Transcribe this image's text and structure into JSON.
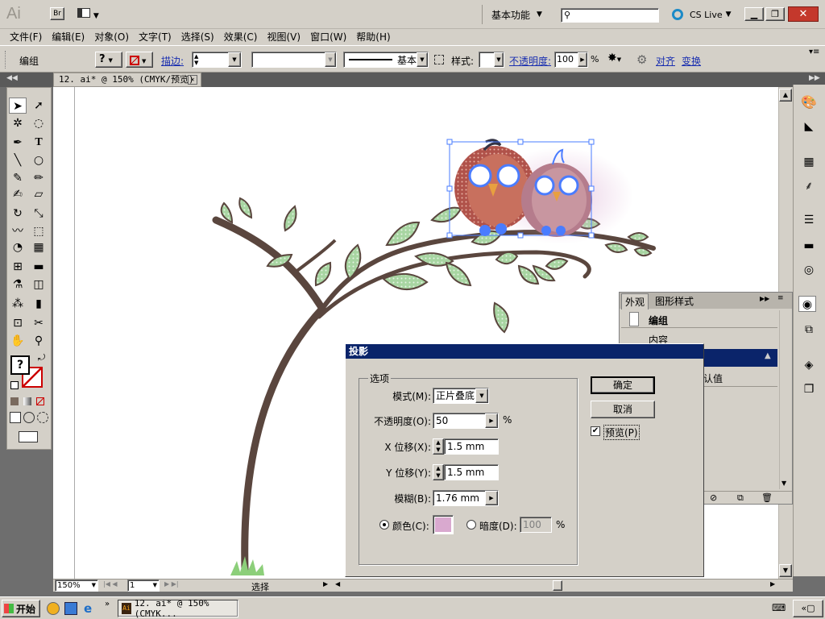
{
  "app": {
    "logo": "Ai",
    "br_badge": "Br",
    "workspace": "基本功能",
    "search_placeholder": "",
    "cs_live": "CS Live"
  },
  "menu": [
    "文件(F)",
    "编辑(E)",
    "对象(O)",
    "文字(T)",
    "选择(S)",
    "效果(C)",
    "视图(V)",
    "窗口(W)",
    "帮助(H)"
  ],
  "control_bar": {
    "selection_label": "编组",
    "stroke_label": "描边:",
    "stroke_style": "基本",
    "style_label": "样式:",
    "opacity_label": "不透明度:",
    "opacity_value": "100",
    "opacity_unit": "%",
    "align_link": "对齐",
    "transform_link": "变换"
  },
  "document": {
    "tab_title": "12. ai* @ 150% (CMYK/预览)"
  },
  "status_bar": {
    "zoom": "150%",
    "page": "1",
    "tool_status": "选择"
  },
  "appearance_panel": {
    "tab_appearance": "外观",
    "tab_graphic_styles": "图形样式",
    "item_group": "编组",
    "item_contents": "内容",
    "item_default": "认值"
  },
  "dialog": {
    "title": "投影",
    "options_group": "选项",
    "mode_label": "模式(M):",
    "mode_value": "正片叠底",
    "opacity_label": "不透明度(O):",
    "opacity_value": "50",
    "opacity_unit": "%",
    "x_offset_label": "X 位移(X):",
    "x_offset_value": "1.5 mm",
    "y_offset_label": "Y 位移(Y):",
    "y_offset_value": "1.5 mm",
    "blur_label": "模糊(B):",
    "blur_value": "1.76 mm",
    "color_label": "颜色(C):",
    "color_swatch": "#d9a9cf",
    "darkness_label": "暗度(D):",
    "darkness_value": "100",
    "darkness_unit": "%",
    "ok_label": "确定",
    "cancel_label": "取消",
    "preview_label": "预览(P)",
    "preview_checked": true,
    "color_selected": true
  },
  "taskbar": {
    "start_label": "开始",
    "task_label": "12. ai* @ 150% (CMYK..."
  },
  "colors": {
    "dialog_title_bg": "#0a246a",
    "leaf_green": "#a8d5a2",
    "branch_brown": "#5a463e",
    "bird_red": "#c8705e",
    "selection_blue": "#4a7cff"
  }
}
